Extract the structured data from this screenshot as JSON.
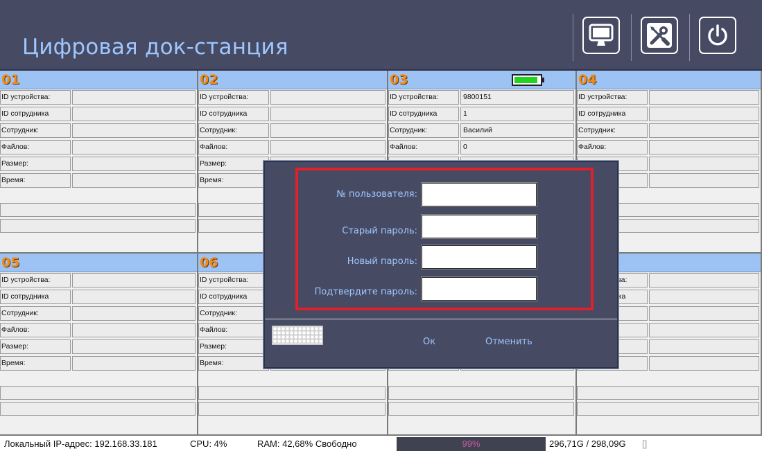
{
  "app": {
    "title": "Цифровая док-станция"
  },
  "header": {
    "buttons": [
      {
        "name": "monitor-icon"
      },
      {
        "name": "settings-tools-icon"
      },
      {
        "name": "power-icon"
      }
    ]
  },
  "panel_labels": {
    "device_id": "ID устройства:",
    "employee_id": "ID сотрудника",
    "employee": "Сотрудник:",
    "files": "Файлов:",
    "size": "Размер:",
    "time": "Время:"
  },
  "panels": [
    {
      "num": "01",
      "device_id": "",
      "employee_id": "",
      "employee": "",
      "files": "",
      "size": "",
      "time": ""
    },
    {
      "num": "02",
      "device_id": "",
      "employee_id": "",
      "employee": "",
      "files": "",
      "size": "",
      "time": ""
    },
    {
      "num": "03",
      "device_id": "9800151",
      "employee_id": "1",
      "employee": "Василий",
      "files": "0",
      "size": "",
      "time": "",
      "battery": true
    },
    {
      "num": "04",
      "device_id": "",
      "employee_id": "",
      "employee": "",
      "files": "",
      "size": "",
      "time": ""
    },
    {
      "num": "05",
      "device_id": "",
      "employee_id": "",
      "employee": "",
      "files": "",
      "size": "",
      "time": ""
    },
    {
      "num": "06",
      "device_id": "",
      "employee_id": "",
      "employee": "",
      "files": "",
      "size": "",
      "time": ""
    },
    {
      "num": "",
      "device_id": "",
      "employee_id": "",
      "employee": "",
      "files": "",
      "size": "",
      "time": ""
    },
    {
      "num": "",
      "device_id": "",
      "employee_id": "",
      "employee": "",
      "files": "",
      "size": "",
      "time": ""
    }
  ],
  "dialog": {
    "fields": [
      {
        "label": "№ пользователя:",
        "value": ""
      },
      {
        "label": "Старый пароль:",
        "value": ""
      },
      {
        "label": "Новый пароль:",
        "value": ""
      },
      {
        "label": "Подтвердите пароль:",
        "value": ""
      }
    ],
    "ok_label": "Ок",
    "cancel_label": "Отменить"
  },
  "status": {
    "ip": "Локальный IP-адрес: 192.168.33.181",
    "cpu": "CPU:   4%",
    "ram": "RAM: 42,68% Свободно",
    "disk_percent": "99%",
    "disk_usage": "296,71G / 298,09G",
    "extra": "[]"
  },
  "colors": {
    "header_bg": "#474a63",
    "title": "#9ec7ff",
    "panel_head": "#9dc3f5",
    "panel_number": "#f08a1a",
    "highlight_border": "#e0202a",
    "battery_fill": "#22d422"
  }
}
